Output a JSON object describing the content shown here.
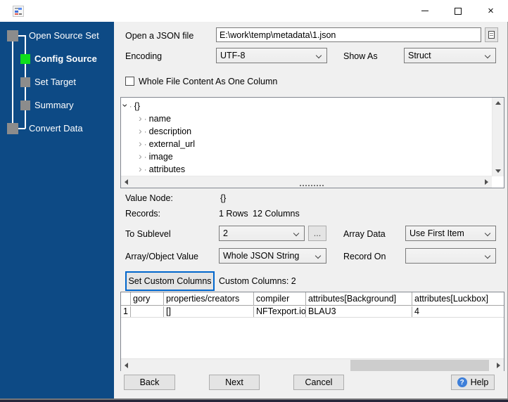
{
  "sidebar": {
    "steps": [
      {
        "label": "Open Source Set"
      },
      {
        "label": "Config Source"
      },
      {
        "label": "Set Target"
      },
      {
        "label": "Summary"
      },
      {
        "label": "Convert Data"
      }
    ]
  },
  "form": {
    "file": {
      "label": "Open a JSON file",
      "value": "E:\\work\\temp\\metadata\\1.json"
    },
    "encoding": {
      "label": "Encoding",
      "value": "UTF-8"
    },
    "show_as": {
      "label": "Show As",
      "value": "Struct"
    },
    "whole_file": {
      "label": "Whole File Content As One Column"
    }
  },
  "tree": {
    "root": "{}",
    "children": [
      "name",
      "description",
      "external_url",
      "image",
      "attributes"
    ]
  },
  "config": {
    "value_node": {
      "label": "Value Node:",
      "value": "{}"
    },
    "records": {
      "label": "Records:",
      "rows": "1 Rows",
      "columns": "12 Columns"
    },
    "to_sublevel": {
      "label": "To Sublevel",
      "value": "2"
    },
    "more_button": "...",
    "array_data": {
      "label": "Array Data",
      "value": "Use First Item"
    },
    "array_object_value": {
      "label": "Array/Object Value",
      "value": "Whole JSON String"
    },
    "record_on": {
      "label": "Record On",
      "value": ""
    },
    "set_custom_columns": {
      "button": "Set Custom Columns",
      "status": "Custom Columns: 2"
    }
  },
  "table": {
    "columns": [
      "",
      "gory",
      "properties/creators",
      "compiler",
      "attributes[Background]",
      "attributes[Luckbox]"
    ],
    "rows": [
      [
        "1",
        "",
        "[]",
        "NFTexport.io",
        "BLAU3",
        "4"
      ]
    ]
  },
  "footer": {
    "back": "Back",
    "next": "Next",
    "cancel": "Cancel",
    "help": "Help"
  },
  "colors": {
    "sidebar_bg": "#0D4A85",
    "active_step": "#0FDE1B",
    "inactive_step": "#8C8C8C",
    "focus_border": "#0066CC",
    "help_icon": "#3E7FD9"
  }
}
